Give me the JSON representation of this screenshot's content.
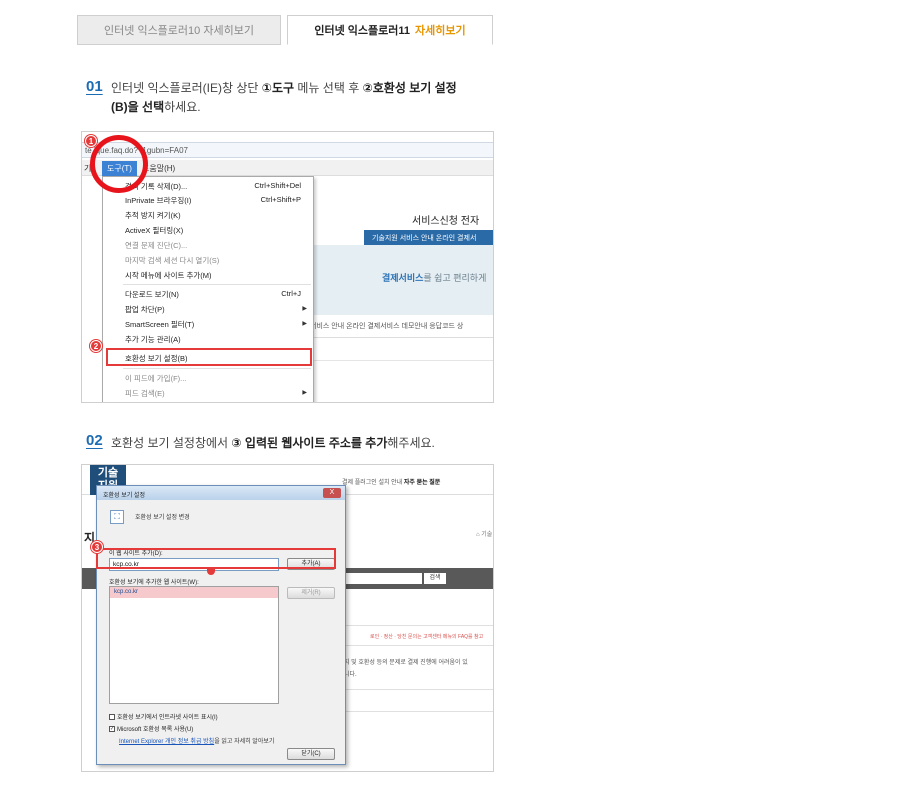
{
  "tabs": [
    {
      "label": "인터넷 익스플로러10 자세히보기",
      "active": false
    },
    {
      "label": "인터넷 익스플로러11",
      "accent": "자세히보기",
      "active": true
    }
  ],
  "colors": {
    "step_number": "#1d6bb3",
    "accent": "#e79600",
    "highlight": "#e53a3a"
  },
  "step1": {
    "number": "01",
    "line1_a": "인터넷 익스플로러(IE)창 상단 ",
    "line1_b": "①도구",
    "line1_c": " 메뉴 선택 후 ",
    "line1_d": "②호환성 보기 설정",
    "line2_a": "(B)을 선택",
    "line2_b": "하세요."
  },
  "shot1": {
    "address": "te   ique.faq.do?    f1gubn=FA07",
    "menubar": {
      "left": "기(",
      "tools": "도구(T)",
      "help": "도움말(H)"
    },
    "menu_items": [
      {
        "label": "검색 기록 삭제(D)...",
        "shortcut": "Ctrl+Shift+Del"
      },
      {
        "label": "InPrivate 브라우징(I)",
        "shortcut": "Ctrl+Shift+P"
      },
      {
        "label": "추적 방지 켜기(K)",
        "shortcut": ""
      },
      {
        "label": "ActiveX 필터링(X)",
        "shortcut": ""
      },
      {
        "label": "연결 문제 진단(C)...",
        "shortcut": "",
        "disabled": true
      },
      {
        "label": "마지막 검색 세션 다시 열기(S)",
        "shortcut": "",
        "disabled": true
      },
      {
        "label": "시작 메뉴에 사이트 추가(M)",
        "shortcut": ""
      },
      {
        "label": "다운로드 보기(N)",
        "shortcut": "Ctrl+J"
      },
      {
        "label": "팝업 차단(P)",
        "shortcut": "",
        "arrow": true
      },
      {
        "label": "SmartScreen 필터(T)",
        "shortcut": "",
        "arrow": true
      },
      {
        "label": "추가 기능 관리(A)",
        "shortcut": ""
      },
      {
        "label": "호환성 보기 설정(B)",
        "shortcut": "",
        "highlighted": true
      },
      {
        "label": "이 피드에 가입(F)...",
        "shortcut": "",
        "disabled": true
      },
      {
        "label": "피드 검색(E)",
        "shortcut": "",
        "disabled": true,
        "arrow": true
      }
    ],
    "page": {
      "header_links": "서비스신청     전자",
      "blue_bar": "기술지원 서비스 안내   온라인 결제서",
      "band_bold": "결제서비스",
      "band_rest": "를 쉽고 편리하게",
      "nav": "서비스 안내   온라인 결제서비스 데모안내   응답코드 상"
    },
    "badge1": "1",
    "badge2": "2"
  },
  "step2": {
    "number": "02",
    "text_a": "호환성 보기 설정창에서 ",
    "text_b": "③ 입력된 웹사이트 주소를 추가",
    "text_c": "해주세요."
  },
  "shot2": {
    "logo": "기술\n지원",
    "nav_a": "결제 플러그인 설치 안내   ",
    "nav_b": "자주 묻는 질문",
    "page_title": "지",
    "home": "⌂ 기술",
    "search_btn": "검색",
    "note": "로인 · 정산 · 당친 문의는 고객센터 메뉴의 FAQ를 참고",
    "body1": "지 및 호환성 등의 문제로 결제 진행에 어려움이 있",
    "body2": "니다.",
    "dialog": {
      "title": "호환성 보기 설정",
      "close": "X",
      "header": "호환성 보기 설정 변경",
      "add_label": "이 웹 사이트 추가(D):",
      "input_value": "kcp.co.kr",
      "add_button": "추가(A)",
      "list_label": "호환성 보기에 추가한 웹 사이트(W):",
      "list_items": [
        "kcp.co.kr"
      ],
      "remove_button": "제거(R)",
      "check1": "호환성 보기에서 인트라넷 사이트 표시(I)",
      "check2": "Microsoft 호환성 목록 사용(U)",
      "link": "Internet Explorer 개인 정보 취급 방침",
      "link_rest": "을 읽고 자세히 알아보기",
      "close_button": "닫기(C)"
    },
    "badge3": "3"
  }
}
